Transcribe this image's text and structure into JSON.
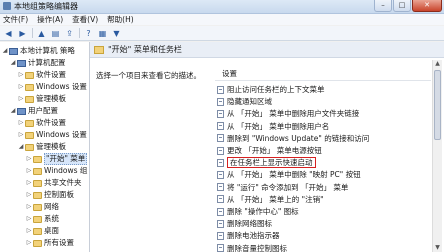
{
  "window": {
    "title": "本地组策略编辑器"
  },
  "menubar": [
    "文件(F)",
    "操作(A)",
    "查看(V)",
    "帮助(H)"
  ],
  "toolbar": [
    "back-icon",
    "forward-icon",
    "up-folder-icon",
    "show-hide-tree-icon",
    "export-icon",
    "help-icon",
    "properties-icon",
    "filter-icon"
  ],
  "tree": [
    {
      "label": "本地计算机 策略",
      "level": 0,
      "icon": "computer-icon",
      "expanded": true
    },
    {
      "label": "计算机配置",
      "level": 1,
      "icon": "computer-icon",
      "expanded": true
    },
    {
      "label": "软件设置",
      "level": 2,
      "icon": "folder-icon",
      "expanded": false
    },
    {
      "label": "Windows 设置",
      "level": 2,
      "icon": "folder-icon",
      "expanded": false
    },
    {
      "label": "管理模板",
      "level": 2,
      "icon": "folder-icon",
      "expanded": false
    },
    {
      "label": "用户配置",
      "level": 1,
      "icon": "computer-icon",
      "expanded": true
    },
    {
      "label": "软件设置",
      "level": 2,
      "icon": "folder-icon",
      "expanded": false
    },
    {
      "label": "Windows 设置",
      "level": 2,
      "icon": "folder-icon",
      "expanded": false
    },
    {
      "label": "管理模板",
      "level": 2,
      "icon": "folder-icon",
      "expanded": true
    },
    {
      "label": "\"开始\" 菜单",
      "level": 3,
      "icon": "folder-icon",
      "expanded": false,
      "selected": true
    },
    {
      "label": "Windows 组",
      "level": 3,
      "icon": "folder-icon",
      "expanded": false
    },
    {
      "label": "共享文件夹",
      "level": 3,
      "icon": "folder-icon",
      "expanded": false
    },
    {
      "label": "控制面板",
      "level": 3,
      "icon": "folder-icon",
      "expanded": false
    },
    {
      "label": "网络",
      "level": 3,
      "icon": "folder-icon",
      "expanded": false
    },
    {
      "label": "系统",
      "level": 3,
      "icon": "folder-icon",
      "expanded": false
    },
    {
      "label": "桌面",
      "level": 3,
      "icon": "folder-icon",
      "expanded": false
    },
    {
      "label": "所有设置",
      "level": 3,
      "icon": "folder-icon",
      "expanded": false
    }
  ],
  "right": {
    "header": "\"开始\" 菜单和任务栏",
    "description": "选择一个项目来查看它的描述。",
    "list_header": "设置",
    "items": [
      "阻止访问任务栏的上下文菜单",
      "隐藏通知区域",
      "从 「开始」 菜单中删除用户文件夹链接",
      "从 「开始」 菜单中删除用户名",
      "删除到 \"Windows Update\" 的链接和访问",
      "更改 「开始」 菜单电源按钮",
      "在任务栏上显示快速启动",
      "从 「开始」 菜单中删除 \"映射 PC\" 按钮",
      "将 \"运行\" 命令添加到 「开始」 菜单",
      "从 「开始」 菜单上的 \"注销\"",
      "删除 \"操作中心\" 图标",
      "删除网络图标",
      "删除电池指示器",
      "删除音量控制图标"
    ],
    "highlighted_index": 6
  },
  "accent": {
    "highlight_box": "#d62020",
    "selection": "#d7e6fa"
  }
}
